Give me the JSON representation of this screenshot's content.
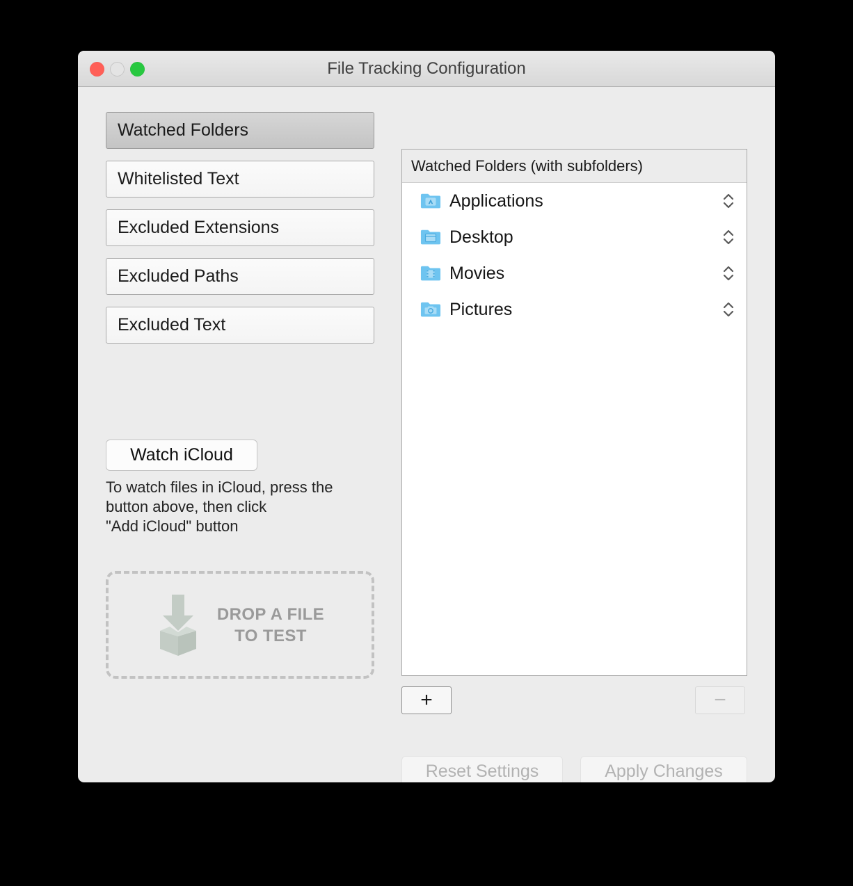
{
  "window": {
    "title": "File Tracking Configuration",
    "traffic_lights": [
      {
        "name": "close",
        "color": "#ff5f57"
      },
      {
        "name": "minimize",
        "color": "#e4e4e4"
      },
      {
        "name": "zoom",
        "color": "#28c840"
      }
    ]
  },
  "sidebar": {
    "items": [
      {
        "label": "Watched Folders",
        "selected": true
      },
      {
        "label": "Whitelisted Text",
        "selected": false
      },
      {
        "label": "Excluded Extensions",
        "selected": false
      },
      {
        "label": "Excluded Paths",
        "selected": false
      },
      {
        "label": "Excluded Text",
        "selected": false
      }
    ]
  },
  "icloud": {
    "button_label": "Watch iCloud",
    "help_text": "To watch files in iCloud, press the\nbutton above, then click\n\"Add iCloud\" button"
  },
  "dropzone": {
    "icon": "drop-file-box-icon",
    "label": "DROP A FILE\nTO TEST",
    "border_color": "#c2c2c2",
    "icon_color": "#c3ccc5",
    "text_color": "#9a9a9a"
  },
  "list": {
    "header": "Watched Folders (with subfolders)",
    "rows": [
      {
        "label": "Applications",
        "icon": "folder-applications-icon",
        "stepper": "stepper-icon"
      },
      {
        "label": "Desktop",
        "icon": "folder-desktop-icon",
        "stepper": "stepper-icon"
      },
      {
        "label": "Movies",
        "icon": "folder-movies-icon",
        "stepper": "stepper-icon"
      },
      {
        "label": "Pictures",
        "icon": "folder-pictures-icon",
        "stepper": "stepper-icon"
      }
    ],
    "folder_color": "#6ec4f0"
  },
  "controls": {
    "add_label": "+",
    "remove_label": "−",
    "add_enabled": true,
    "remove_enabled": false
  },
  "footer": {
    "reset_label": "Reset Settings",
    "apply_label": "Apply Changes",
    "reset_enabled": false,
    "apply_enabled": false
  }
}
